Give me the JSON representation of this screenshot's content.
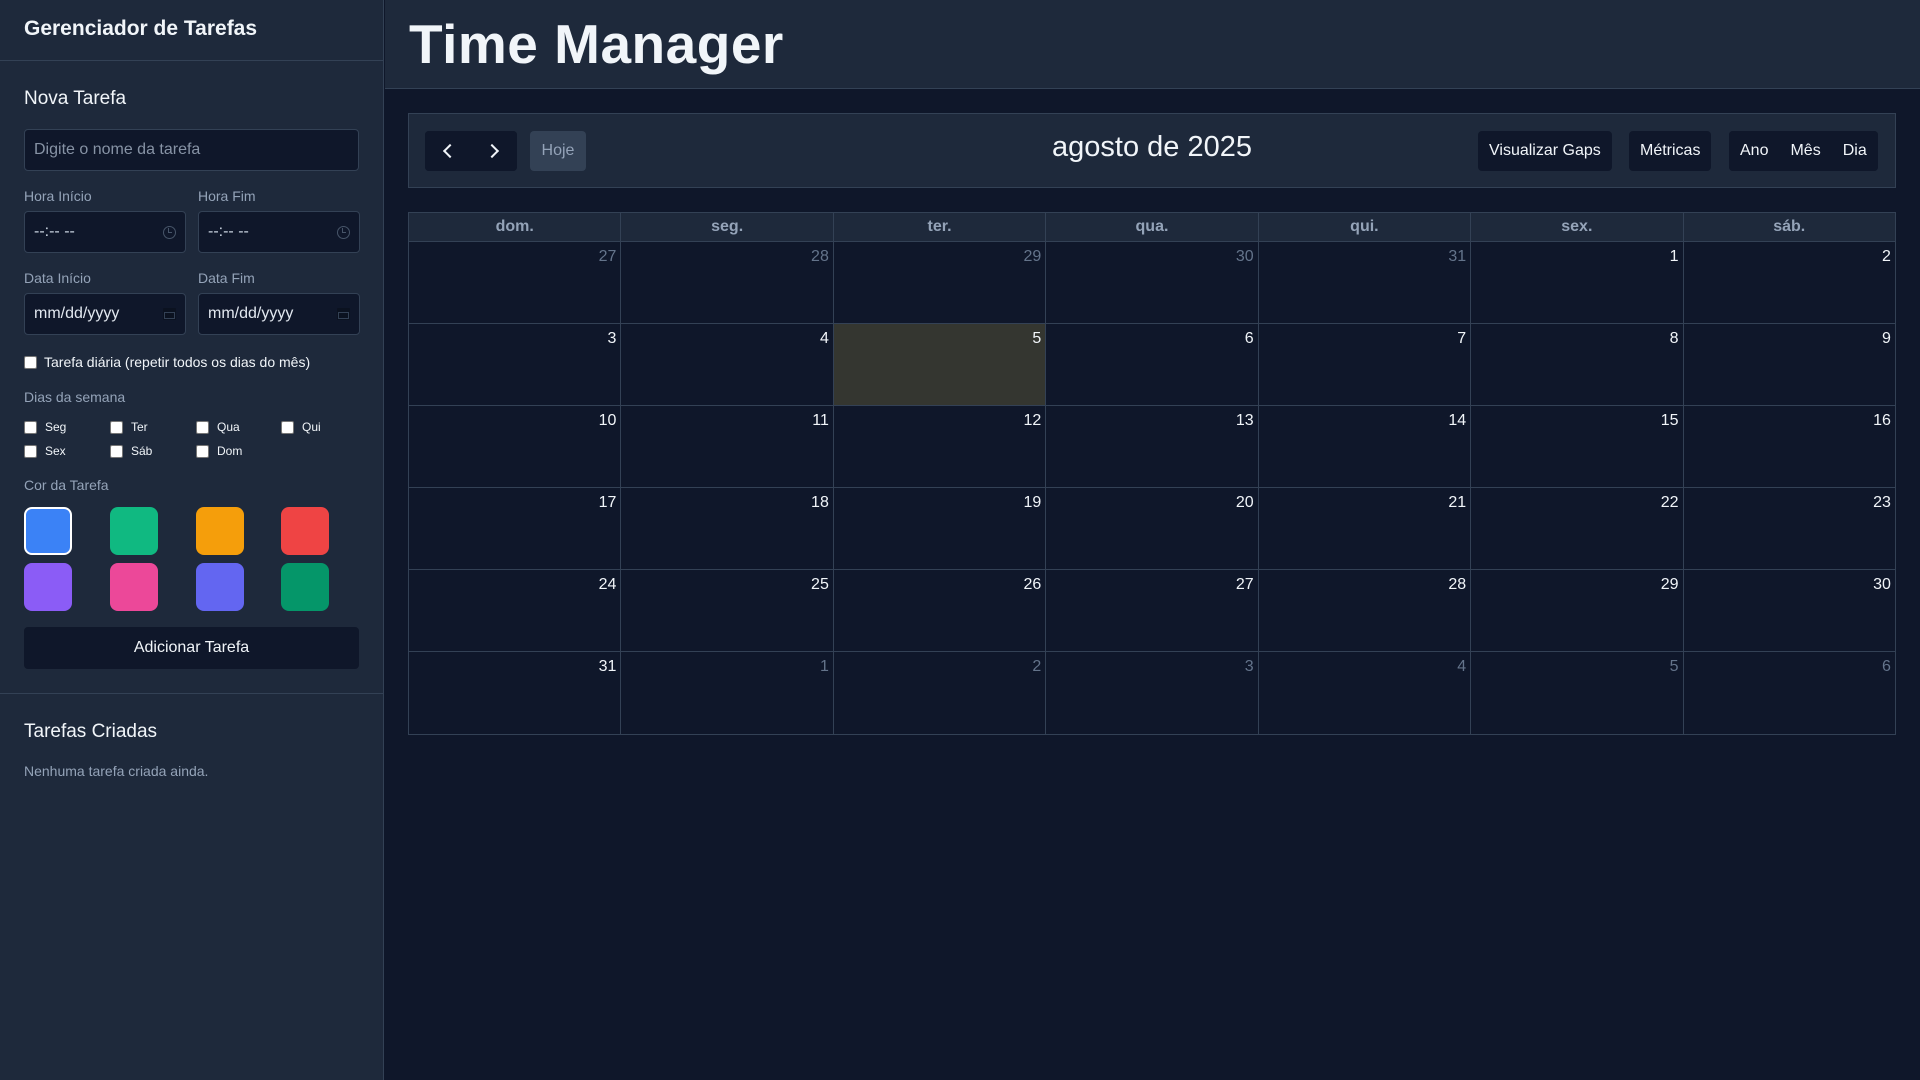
{
  "sidebar": {
    "title": "Gerenciador de Tarefas",
    "new_task_heading": "Nova Tarefa",
    "task_name_placeholder": "Digite o nome da tarefa",
    "start_time_label": "Hora Início",
    "end_time_label": "Hora Fim",
    "time_placeholder": "--:-- --",
    "start_date_label": "Data Início",
    "end_date_label": "Data Fim",
    "date_placeholder": "mm/dd/yyyy",
    "daily_label": "Tarefa diária (repetir todos os dias do mês)",
    "weekdays_label": "Dias da semana",
    "weekdays": [
      "Seg",
      "Ter",
      "Qua",
      "Qui",
      "Sex",
      "Sáb",
      "Dom"
    ],
    "color_label": "Cor da Tarefa",
    "colors": [
      "#3b82f6",
      "#10b981",
      "#f59e0b",
      "#ef4444",
      "#8b5cf6",
      "#ec4899",
      "#6366f1",
      "#059669"
    ],
    "selected_color": "#3b82f6",
    "add_button": "Adicionar Tarefa",
    "created_heading": "Tarefas Criadas",
    "empty_text": "Nenhuma tarefa criada ainda."
  },
  "header": {
    "title": "Time Manager"
  },
  "toolbar": {
    "today_label": "Hoje",
    "month_title": "agosto de 2025",
    "gaps_label": "Visualizar Gaps",
    "metrics_label": "Métricas",
    "views": [
      "Ano",
      "Mês",
      "Dia"
    ]
  },
  "calendar": {
    "weekday_headers": [
      "dom.",
      "seg.",
      "ter.",
      "qua.",
      "qui.",
      "sex.",
      "sáb."
    ],
    "today": 5,
    "weeks": [
      [
        {
          "d": "27",
          "o": true
        },
        {
          "d": "28",
          "o": true
        },
        {
          "d": "29",
          "o": true
        },
        {
          "d": "30",
          "o": true
        },
        {
          "d": "31",
          "o": true
        },
        {
          "d": "1"
        },
        {
          "d": "2"
        }
      ],
      [
        {
          "d": "3"
        },
        {
          "d": "4"
        },
        {
          "d": "5",
          "t": true
        },
        {
          "d": "6"
        },
        {
          "d": "7"
        },
        {
          "d": "8"
        },
        {
          "d": "9"
        }
      ],
      [
        {
          "d": "10"
        },
        {
          "d": "11"
        },
        {
          "d": "12"
        },
        {
          "d": "13"
        },
        {
          "d": "14"
        },
        {
          "d": "15"
        },
        {
          "d": "16"
        }
      ],
      [
        {
          "d": "17"
        },
        {
          "d": "18"
        },
        {
          "d": "19"
        },
        {
          "d": "20"
        },
        {
          "d": "21"
        },
        {
          "d": "22"
        },
        {
          "d": "23"
        }
      ],
      [
        {
          "d": "24"
        },
        {
          "d": "25"
        },
        {
          "d": "26"
        },
        {
          "d": "27"
        },
        {
          "d": "28"
        },
        {
          "d": "29"
        },
        {
          "d": "30"
        }
      ],
      [
        {
          "d": "31"
        },
        {
          "d": "1",
          "o": true
        },
        {
          "d": "2",
          "o": true
        },
        {
          "d": "3",
          "o": true
        },
        {
          "d": "4",
          "o": true
        },
        {
          "d": "5",
          "o": true
        },
        {
          "d": "6",
          "o": true
        }
      ]
    ]
  }
}
